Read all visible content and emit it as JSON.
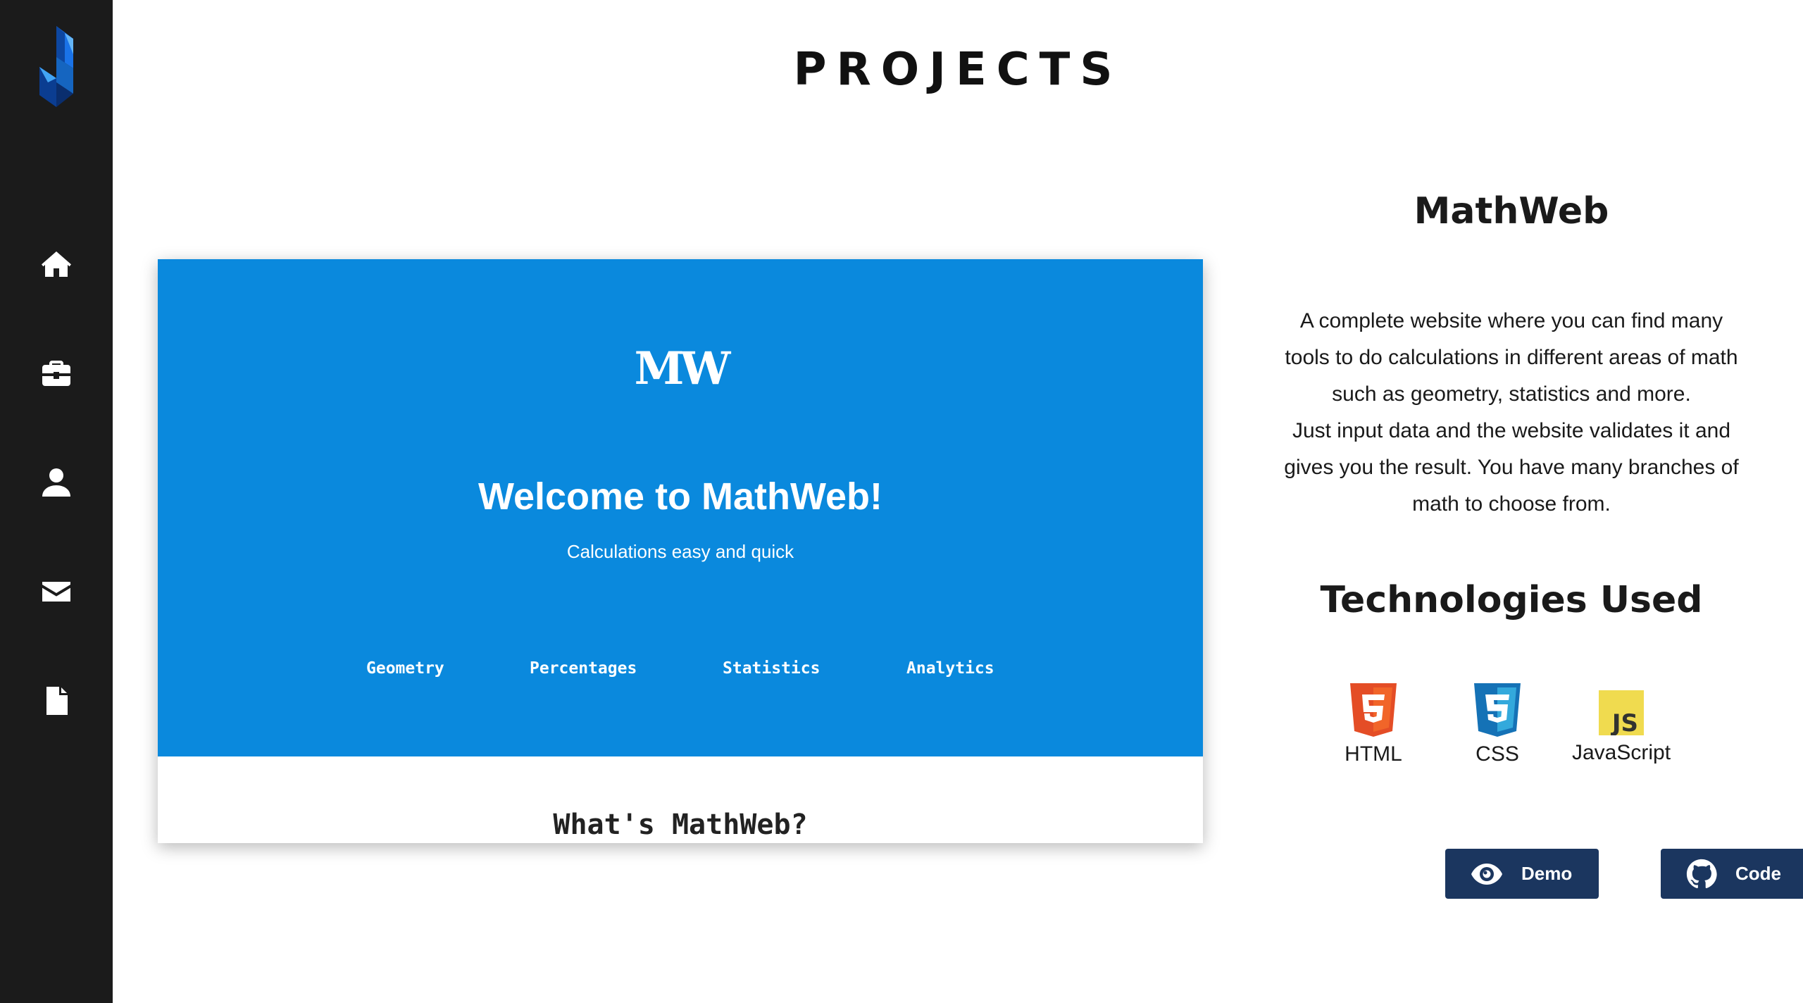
{
  "sidebar": {
    "items": [
      {
        "icon": "home-icon"
      },
      {
        "icon": "briefcase-icon"
      },
      {
        "icon": "user-icon"
      },
      {
        "icon": "envelope-icon"
      },
      {
        "icon": "file-icon"
      }
    ]
  },
  "page": {
    "title": "PROJECTS"
  },
  "preview": {
    "logo": "MW",
    "hero_title": "Welcome to MathWeb!",
    "hero_subtitle": "Calculations easy and quick",
    "nav": [
      "Geometry",
      "Percentages",
      "Statistics",
      "Analytics"
    ],
    "section_heading": "What's MathWeb?",
    "hero_color": "#0a89dd"
  },
  "project": {
    "title": "MathWeb",
    "description_lines": [
      "A complete website where you can find many",
      "tools to do calculations in different areas of math",
      "such as geometry, statistics and more.",
      "Just input data and the website validates it and",
      "gives you the result. You have many branches of",
      "math to choose from."
    ],
    "tech_title": "Technologies Used",
    "technologies": [
      {
        "label": "HTML",
        "icon": "html5-icon",
        "color": "#e44d26"
      },
      {
        "label": "CSS",
        "icon": "css3-icon",
        "color": "#2965f1"
      },
      {
        "label": "JavaScript",
        "icon": "javascript-icon",
        "color": "#f0db4f"
      }
    ],
    "buttons": {
      "demo": "Demo",
      "code": "Code"
    },
    "button_color": "#1b365f"
  }
}
